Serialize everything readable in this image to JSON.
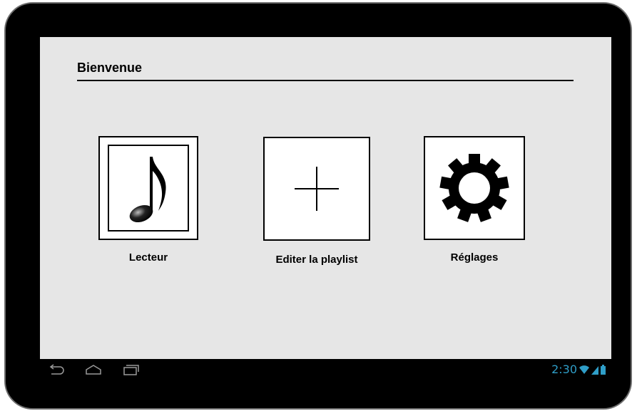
{
  "header": {
    "title": "Bienvenue"
  },
  "tiles": [
    {
      "label": "Lecteur",
      "icon": "music-note-icon"
    },
    {
      "label": "Editer la playlist",
      "icon": "plus-icon"
    },
    {
      "label": "Réglages",
      "icon": "gear-icon"
    }
  ],
  "system_bar": {
    "nav_icons": [
      "back-icon",
      "home-icon",
      "recent-apps-icon"
    ],
    "time": "2:30",
    "status_icons": [
      "wifi-icon",
      "signal-icon",
      "battery-icon"
    ],
    "accent_color": "#2f9ec8"
  }
}
